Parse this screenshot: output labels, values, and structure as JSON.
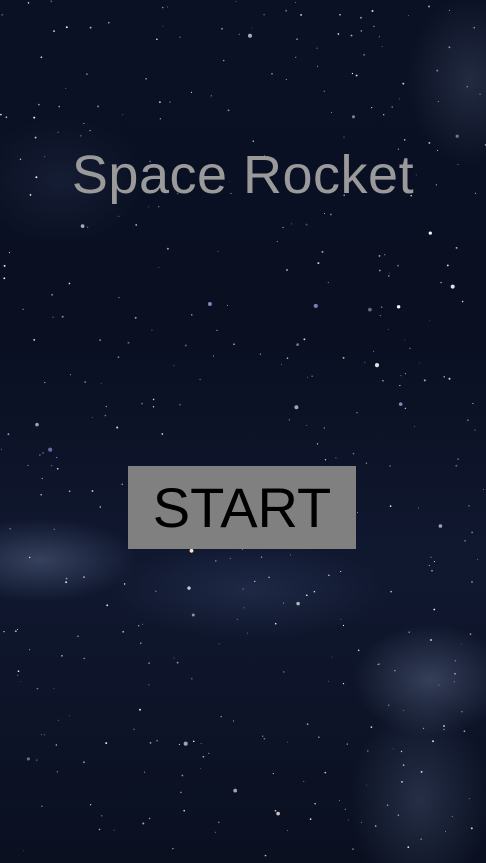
{
  "game": {
    "title": "Space Rocket",
    "start_label": "START"
  },
  "colors": {
    "title_text": "#9a9a9a",
    "button_background": "#808080",
    "button_text": "#000000",
    "background": "#0a1022"
  }
}
